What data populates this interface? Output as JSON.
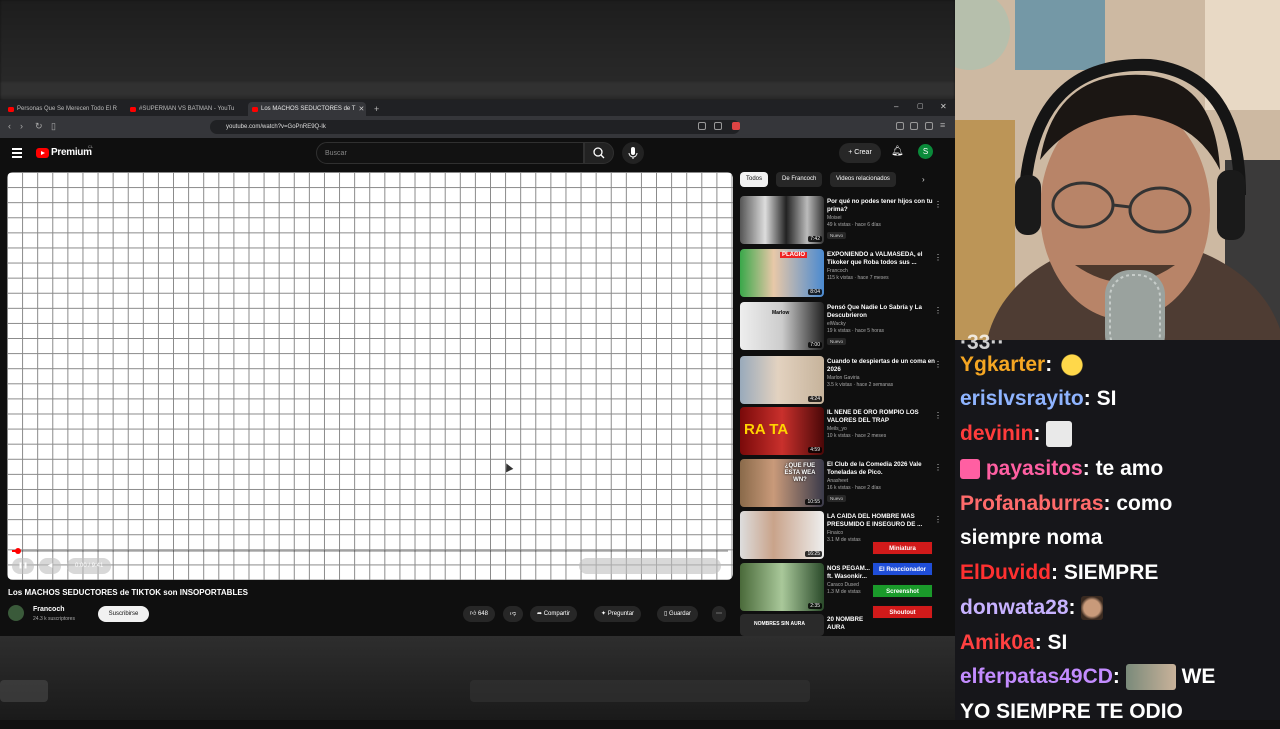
{
  "browser": {
    "tabs": [
      {
        "label": "Personas Que Se Merecen Todo El R"
      },
      {
        "label": "#SUPERMAN VS BATMAN - YouTu"
      },
      {
        "label": "Los MACHOS SEDUCTORES de T"
      }
    ],
    "url": "youtube.com/watch?v=GoPnRE9Q-Ik"
  },
  "youtube": {
    "logo": "Premium",
    "logo_sup": "CL",
    "search_placeholder": "Buscar",
    "create_label": "Crear",
    "avatar_letter": "S",
    "player": {
      "time": "0:00 / 9:41",
      "progress": 0.005
    },
    "video": {
      "title": "Los MACHOS SEDUCTORES de TIKTOK son INSOPORTABLES",
      "channel": "Francoch",
      "subs": "24.3 k suscriptores",
      "subscribe": "Suscribirse",
      "likes": "648",
      "share": "Compartir",
      "ask": "Preguntar",
      "save": "Guardar"
    },
    "chips": [
      "Todos",
      "De Francoch",
      "Videos relacionados"
    ],
    "recs": [
      {
        "title": "Por qué no podes tener hijos con tu prima?",
        "channel": "Moisei",
        "meta": "49 k vistas · hace 6 días",
        "duration": "7:42",
        "badge": "Nuevo"
      },
      {
        "title": "EXPONIENDO a VALMASEDA, el Tikoker que Roba todos sus ...",
        "channel": "Francoch",
        "meta": "115 k vistas · hace 7 meses",
        "duration": "8:04",
        "badge": ""
      },
      {
        "title": "Pensó Que Nadie Lo Sabría y La Descubrieron",
        "channel": "elWacky",
        "meta": "19 k vistas · hace 5 horas",
        "duration": "7:00",
        "badge": "Nuevo"
      },
      {
        "title": "Cuando te despiertas de un coma en 2026",
        "channel": "Marlon Gaviria",
        "meta": "3.5 k vistas · hace 2 semanas",
        "duration": "4:24",
        "badge": ""
      },
      {
        "title": "IL NENE DE ORO ROMPIÓ LOS VALORES DEL TRAP",
        "channel": "Meils_yo",
        "meta": "10 k vistas · hace 2 meses",
        "duration": "4:59",
        "badge": ""
      },
      {
        "title": "El Club de la Comedia 2026 Vale Toneladas de Pico.",
        "channel": "Anasheet",
        "meta": "16 k vistas · hace 2 días",
        "duration": "10:55",
        "badge": "Nuevo"
      },
      {
        "title": "LA CAÍDA DEL HOMBRE MÁS PRESUMIDO E INSEGURO DE ...",
        "channel": "Finaico",
        "meta": "3.1 M de vistas",
        "duration": "16:25",
        "badge": ""
      },
      {
        "title": "NOS PEGAM... ft. Wasonkir...",
        "channel": "Caraco Dused",
        "meta": "1.3 M de vistas",
        "duration": "2:35",
        "badge": ""
      },
      {
        "title": "20 NOMBRE AURA",
        "channel": "",
        "meta": "",
        "duration": "",
        "badge": ""
      }
    ],
    "thumb_texts": {
      "plagio": "PLAGIO",
      "que_fue": "¿QUE FUE ESTA WEA WN?",
      "ra": "RA TA",
      "nombres": "NOMBRES SIN AURA",
      "marlow": "Marlow"
    }
  },
  "overlay_buttons": [
    {
      "label": "Miniatura",
      "color": "#d11a1a"
    },
    {
      "label": "El Reaccionador",
      "color": "#1f4ed8"
    },
    {
      "label": "Screenshot",
      "color": "#1a9a2a"
    },
    {
      "label": "Shoutout",
      "color": "#d11a1a"
    }
  ],
  "chat": [
    {
      "user": "Ygkarter",
      "color": "#f5a623",
      "text": "",
      "emote": "clap-emote"
    },
    {
      "user": "erislvsrayito",
      "color": "#8fb4ff",
      "text": "SI",
      "emote": ""
    },
    {
      "user": "devinin",
      "color": "#ff3c3c",
      "text": "",
      "emote": "sticker-emote"
    },
    {
      "user": "payasitos",
      "color": "#ff5fa2",
      "text": "te amo",
      "emote": "",
      "badge": "rocket-badge"
    },
    {
      "user": "Profanaburras",
      "color": "#ff6b6b",
      "text": "como",
      "emote": ""
    },
    {
      "user": "",
      "color": "#fff",
      "text": "siempre noma",
      "emote": ""
    },
    {
      "user": "ElDuvidd",
      "color": "#ff3030",
      "text": "SIEMPRE",
      "emote": ""
    },
    {
      "user": "donwata28",
      "color": "#c7b2ff",
      "text": "",
      "emote": "face-emote"
    },
    {
      "user": "Amik0a",
      "color": "#ff4040",
      "text": "SI",
      "emote": ""
    },
    {
      "user": "elferpatas49CD",
      "color": "#c38cff",
      "text": "WE",
      "emote": "photo-emote"
    },
    {
      "user": "",
      "color": "#fff",
      "text": "YO SIEMPRE TE ODIO",
      "emote": ""
    }
  ],
  "partial_chat_top": "·33··"
}
